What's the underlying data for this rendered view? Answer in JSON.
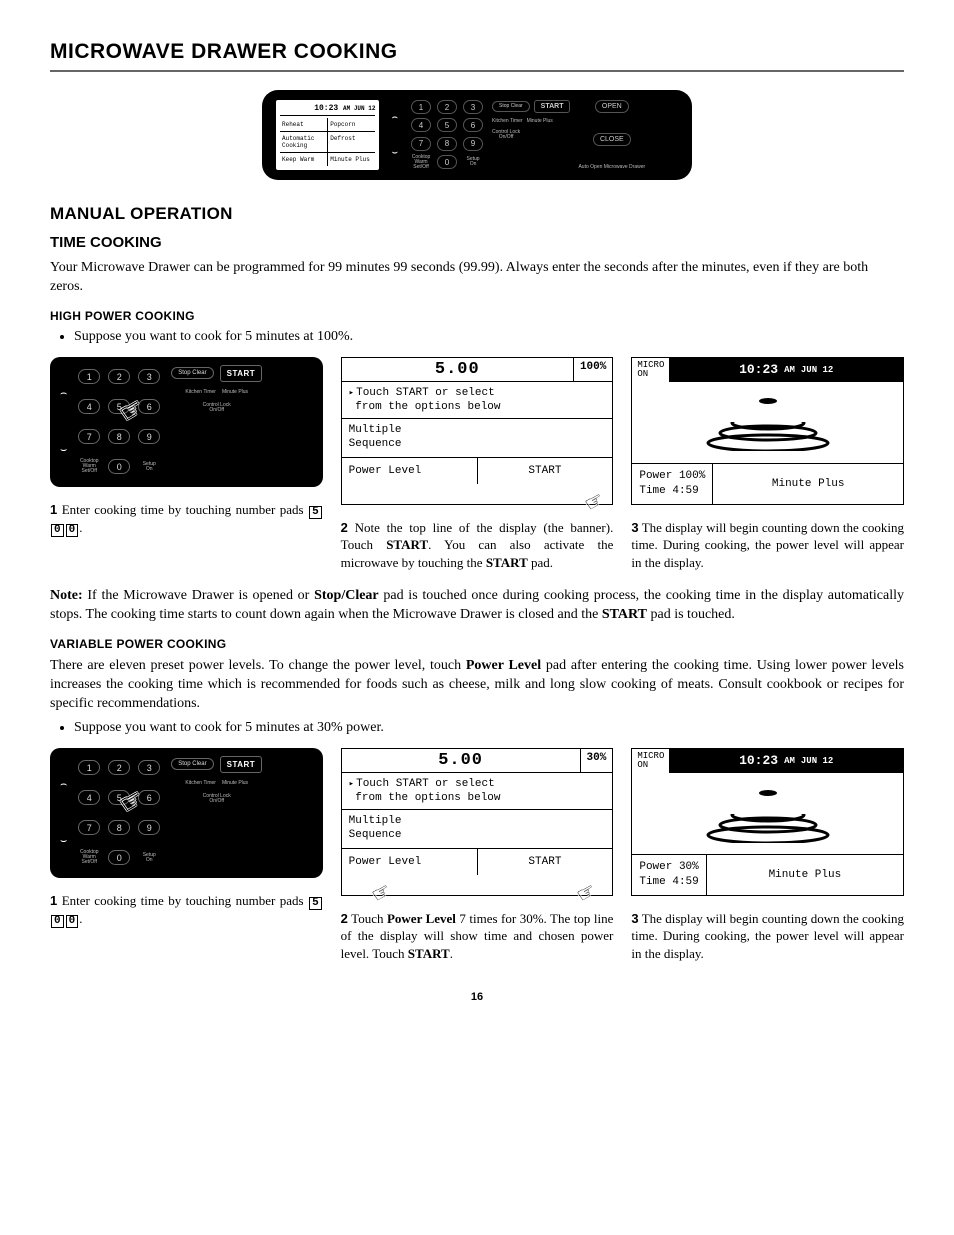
{
  "pageTitle": "MICROWAVE DRAWER COOKING",
  "panel": {
    "clock": "10:23",
    "clockSuffix": "AM  JUN 12",
    "screen": [
      [
        "Reheat",
        "Popcorn"
      ],
      [
        "Automatic Cooking",
        "Defrost"
      ],
      [
        "Keep Warm",
        "Minute Plus"
      ]
    ],
    "keys": [
      "1",
      "2",
      "3",
      "4",
      "5",
      "6",
      "7",
      "8",
      "9",
      "0"
    ],
    "subs": {
      "cooktop": "Cooktop Warm",
      "setoff": "Set/Off",
      "on": "On",
      "setup": "Setup"
    },
    "right": {
      "stopClear": "Stop Clear",
      "start": "START",
      "kitchenTimer": "Kitchen Timer",
      "minutePlus": "Minute Plus",
      "controlLock": "Control Lock",
      "onoff": "On/Off"
    },
    "farRight": {
      "open": "OPEN",
      "close": "CLOSE",
      "auto": "Auto Open Microwave Drawer"
    }
  },
  "sections": {
    "manualOp": "MANUAL OPERATION",
    "timeCooking": "TIME COOKING",
    "timeCookingIntro": "Your Microwave Drawer can be programmed for 99 minutes 99 seconds (99.99). Always enter the seconds after the minutes, even if they are both zeros.",
    "highPower": "HIGH POWER COOKING",
    "hpBullet": "Suppose you want to cook for 5 minutes at 100%.",
    "varPower": "VARIABLE POWER COOKING",
    "varIntro1": "There are eleven preset power levels. To change the power level, touch ",
    "varIntroBold1": "Power Level",
    "varIntro2": " pad after entering the cooking time. Using lower power levels increases the cooking time which is recommended for foods such as cheese, milk and long slow cooking of meats. Consult cookbook or recipes for specific recommendations.",
    "varBullet": "Suppose you want to cook for 5 minutes at 30% power."
  },
  "lcd1": {
    "time": "5.00",
    "pct": "100%",
    "msg1": "Touch START or select",
    "msg2": "from the options below",
    "opt1a": "Multiple",
    "opt1b": "Sequence",
    "botL": "Power Level",
    "botR": "START"
  },
  "cook1": {
    "micro": "MICRO",
    "on": "ON",
    "clock": "10:23",
    "am": "AM",
    "date": "JUN 12",
    "power": "Power 100%",
    "time": "Time  4:59",
    "minplus": "Minute Plus"
  },
  "lcd2": {
    "time": "5.00",
    "pct": "30%",
    "msg1": "Touch START or select",
    "msg2": "from the options below",
    "opt1a": "Multiple",
    "opt1b": "Sequence",
    "botL": "Power Level",
    "botR": "START"
  },
  "cook2": {
    "micro": "MICRO",
    "on": "ON",
    "clock": "10:23",
    "am": "AM",
    "date": "JUN 12",
    "power": "Power  30%",
    "time": "Time  4:59",
    "minplus": "Minute Plus"
  },
  "steps": {
    "hp1a": "Enter cooking time by touching number pads ",
    "hp2a": "Note the top line of the display (the banner). Touch ",
    "hp2b": ". You can also activate the microwave by touching the ",
    "hp2c": " pad.",
    "hp3": "The display will begin counting down the cooking time. During cooking, the power level will appear in the display.",
    "vp2a": "Touch ",
    "vp2b": " 7 times for 30%. The top line of the display will show time and chosen power level. Touch ",
    "start": "START",
    "powerLevel": "Power Level"
  },
  "keypress": [
    "5",
    "0",
    "0"
  ],
  "note": {
    "label": "Note:",
    "t1": " If the Microwave Drawer is opened or ",
    "b1": "Stop/Clear",
    "t2": " pad is touched once during cooking process, the cooking time in the display automatically stops. The cooking time starts to count down again when the Microwave Drawer is closed and the ",
    "b2": "START",
    "t3": " pad is touched."
  },
  "pageNum": "16"
}
